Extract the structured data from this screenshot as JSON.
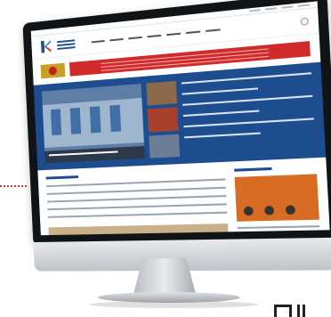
{
  "image": {
    "subject": "desktop-monitor-mockup",
    "screen_content": "news-portal-homepage",
    "colors": {
      "primary_blue": "#1d4d8e",
      "accent_red": "#d12a2a",
      "bezel": "#111416",
      "connector_red": "#c83a3a"
    }
  }
}
